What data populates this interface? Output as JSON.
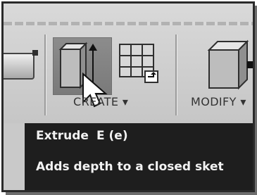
{
  "ribbon": {
    "groups": [
      {
        "label": "CREATE",
        "dropdown_glyph": "▾"
      },
      {
        "label": "MODIFY",
        "dropdown_glyph": "▾"
      }
    ],
    "icons": {
      "sketch_panel": "rectangle-sketch-icon",
      "extrude": "extrude-icon",
      "pattern": "rectangular-pattern-icon",
      "press_pull": "press-pull-icon"
    }
  },
  "tooltip": {
    "title": "Extrude",
    "shortcut": "E (e)",
    "description": "Adds depth to a closed sket"
  },
  "colors": {
    "ribbon_bg": "#c9c9c9",
    "button_active": "#7d7d7d",
    "tooltip_bg": "#1e1e1e",
    "tooltip_text": "#f2f2f2"
  }
}
